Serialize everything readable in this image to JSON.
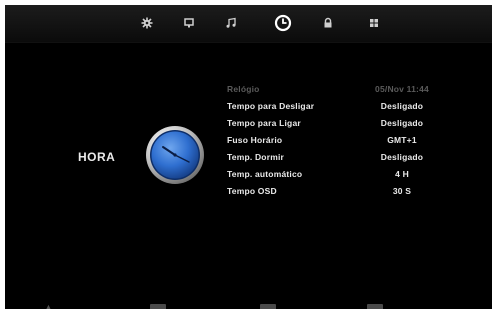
{
  "tabs": [
    {
      "icon": "picture-settings-icon",
      "active": false
    },
    {
      "icon": "monitor-icon",
      "active": false
    },
    {
      "icon": "music-note-icon",
      "active": false
    },
    {
      "icon": "clock-icon",
      "active": true
    },
    {
      "icon": "lock-icon",
      "active": false
    },
    {
      "icon": "apps-grid-icon",
      "active": false
    }
  ],
  "section": {
    "title": "HORA"
  },
  "settings": [
    {
      "label": "Relógio",
      "value": "05/Nov 11:44",
      "disabled": true
    },
    {
      "label": "Tempo para Desligar",
      "value": "Desligado"
    },
    {
      "label": "Tempo para Ligar",
      "value": "Desligado"
    },
    {
      "label": "Fuso Horário",
      "value": "GMT+1"
    },
    {
      "label": "Temp. Dormir",
      "value": "Desligado"
    },
    {
      "label": "Temp. automático",
      "value": "4 H"
    },
    {
      "label": "Tempo OSD",
      "value": "30 S"
    }
  ],
  "colors": {
    "background": "#000000",
    "text": "#eaeaea",
    "disabled_text": "#5a5a5a",
    "clock_face": "#2f6fd0"
  }
}
